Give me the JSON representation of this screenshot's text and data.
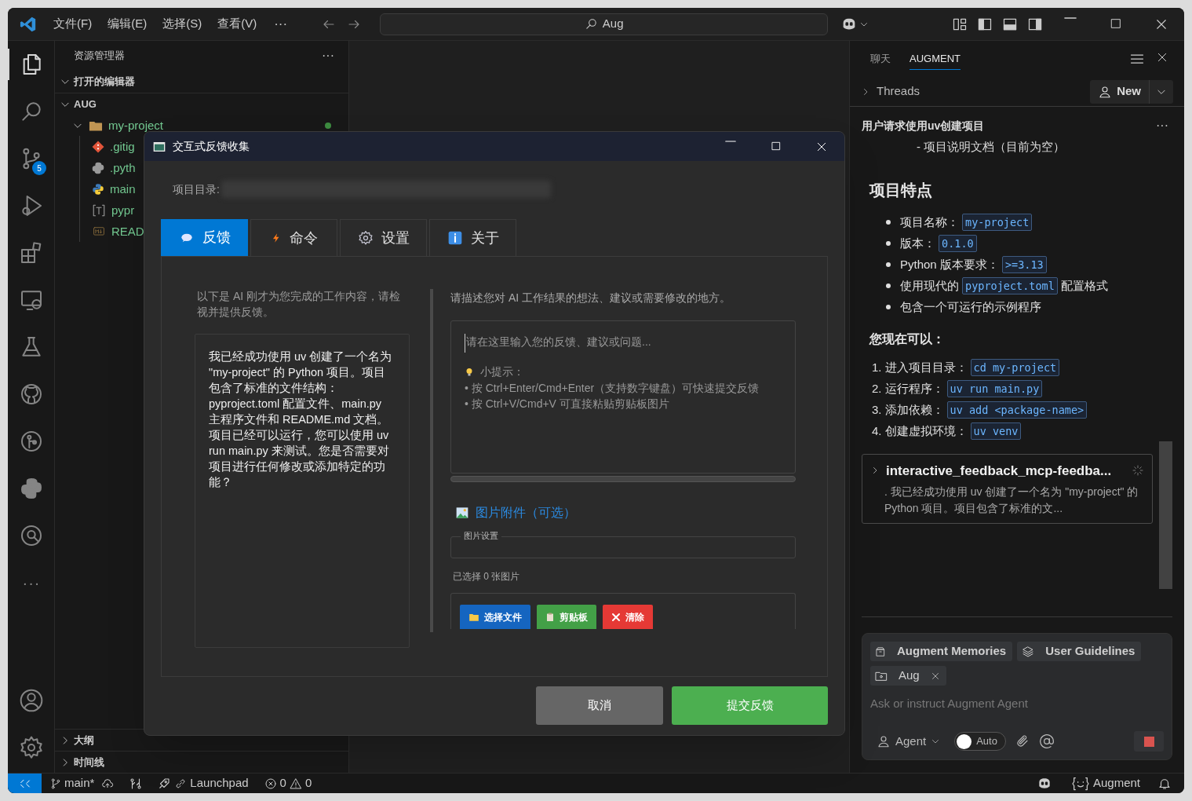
{
  "titlebar": {
    "menus": [
      "文件(F)",
      "编辑(E)",
      "选择(S)",
      "查看(V)"
    ],
    "more": "···",
    "search": "Aug"
  },
  "activity_bar": {
    "items": [
      {
        "kind": "explorer",
        "selected": true
      },
      {
        "kind": "search",
        "selected": false
      },
      {
        "kind": "source-control",
        "selected": false,
        "badge": "5"
      },
      {
        "kind": "run-debug",
        "selected": false
      },
      {
        "kind": "extensions",
        "selected": false
      },
      {
        "kind": "remote",
        "selected": false
      },
      {
        "kind": "testing",
        "selected": false
      },
      {
        "kind": "github",
        "selected": false
      },
      {
        "kind": "git-graph",
        "selected": false
      },
      {
        "kind": "python",
        "selected": false
      },
      {
        "kind": "search-settings",
        "selected": false
      },
      {
        "kind": "more",
        "selected": false,
        "label": "···"
      }
    ],
    "bottom": [
      {
        "kind": "account"
      },
      {
        "kind": "settings"
      }
    ]
  },
  "sidebar": {
    "title": "资源管理器",
    "more": "···",
    "sections": [
      {
        "label": "打开的编辑器",
        "expanded": true
      },
      {
        "label": "AUG",
        "expanded": true,
        "tree": [
          {
            "label": "my-project",
            "kind": "folder",
            "expanded": true,
            "modified": true,
            "children": [
              {
                "label": ".gitig",
                "kind": "git"
              },
              {
                "label": ".pyth",
                "kind": "python-gray"
              },
              {
                "label": "main",
                "kind": "python"
              },
              {
                "label": "pypr",
                "kind": "toml"
              },
              {
                "label": "READ",
                "kind": "markdown"
              }
            ]
          }
        ]
      }
    ],
    "bottom_sections": [
      {
        "label": "大纲",
        "expanded": false
      },
      {
        "label": "时间线",
        "expanded": false
      }
    ]
  },
  "dialog": {
    "title": "交互式反馈收集",
    "project_label": "项目目录:",
    "tabs": [
      {
        "label": "反馈",
        "kind": "feedback",
        "selected": true
      },
      {
        "label": "命令",
        "kind": "command",
        "selected": false
      },
      {
        "label": "设置",
        "kind": "settings",
        "selected": false
      },
      {
        "label": "关于",
        "kind": "about",
        "selected": false
      }
    ],
    "summary_prompt": "以下是 AI 刚才为您完成的工作内容，请检视并提供反馈。",
    "summary": "我已经成功使用 uv 创建了一个名为 \"my-project\" 的 Python 项目。项目包含了标准的文件结构：pyproject.toml 配置文件、main.py 主程序文件和 README.md 文档。项目已经可以运行，您可以使用 uv run main.py 来测试。您是否需要对项目进行任何修改或添加特定的功能？",
    "feedback_prompt": "请描述您对 AI 工作结果的想法、建议或需要修改的地方。",
    "feedback": {
      "placeholder": "请在这里输入您的反馈、建议或问题...",
      "tip_title": "小提示：",
      "tips": [
        "• 按 Ctrl+Enter/Cmd+Enter（支持数字键盘）可快速提交反馈",
        "• 按 Ctrl+V/Cmd+V 可直接粘贴剪贴板图片"
      ]
    },
    "images": {
      "title": "图片附件（可选）",
      "settings": "图片设置",
      "count": "已选择 0 张图片",
      "buttons": [
        {
          "label": "选择文件",
          "kind": "choose"
        },
        {
          "label": "剪贴板",
          "kind": "clipboard"
        },
        {
          "label": "清除",
          "kind": "clear"
        }
      ]
    },
    "actions": [
      {
        "label": "取消",
        "kind": "cancel"
      },
      {
        "label": "提交反馈",
        "kind": "submit"
      }
    ]
  },
  "right_panel": {
    "tabs": [
      {
        "label": "聊天",
        "selected": false
      },
      {
        "label": "AUGMENT",
        "selected": true
      }
    ],
    "threads": "Threads",
    "new": "New",
    "thread_title": "用户请求使用uv创建项目",
    "more": "···",
    "partial_line": "- 项目说明文档（目前为空）",
    "heading": "项目特点",
    "bullets": [
      [
        {
          "kind": "text",
          "text": "项目名称："
        },
        {
          "kind": "code",
          "text": "my-project"
        }
      ],
      [
        {
          "kind": "text",
          "text": "版本："
        },
        {
          "kind": "code",
          "text": "0.1.0"
        }
      ],
      [
        {
          "kind": "text",
          "text": "Python 版本要求："
        },
        {
          "kind": "code",
          "text": ">=3.13"
        }
      ],
      [
        {
          "kind": "text",
          "text": "使用现代的"
        },
        {
          "kind": "code",
          "text": "pyproject.toml"
        },
        {
          "kind": "text",
          "text": "配置格式"
        }
      ],
      [
        {
          "kind": "text",
          "text": "包含一个可运行的示例程序"
        }
      ]
    ],
    "subheading": "您现在可以：",
    "steps": [
      {
        "number": "1.",
        "segments": [
          {
            "kind": "text",
            "text": "进入项目目录："
          },
          {
            "kind": "code",
            "text": "cd my-project"
          }
        ]
      },
      {
        "number": "2.",
        "segments": [
          {
            "kind": "text",
            "text": "运行程序："
          },
          {
            "kind": "code",
            "text": "uv run main.py"
          }
        ]
      },
      {
        "number": "3.",
        "segments": [
          {
            "kind": "text",
            "text": "添加依赖："
          },
          {
            "kind": "code",
            "text": "uv add <package-name>"
          }
        ]
      },
      {
        "number": "4.",
        "segments": [
          {
            "kind": "text",
            "text": "创建虚拟环境："
          },
          {
            "kind": "code",
            "text": "uv venv"
          }
        ]
      }
    ],
    "tool_card": {
      "title": "interactive_feedback_mcp-feedba...",
      "text": ". 我已经成功使用 uv 创建了一个名为 \"my-project\" 的 Python 项目。项目包含了标准的文...",
      "expanded": false
    },
    "input": {
      "chips": [
        {
          "label": "Augment Memories",
          "kind": "memories"
        },
        {
          "label": "User Guidelines",
          "kind": "guidelines"
        },
        {
          "label": "Aug",
          "kind": "folder",
          "removable": true
        }
      ],
      "placeholder": "Ask or instruct Augment Agent",
      "mode": "Agent",
      "auto": {
        "label": "Auto",
        "on": false
      }
    }
  },
  "status_bar": {
    "branch": "main*",
    "launchpad": "Launchpad",
    "errors": "0",
    "warnings": "0",
    "augment": "Augment"
  }
}
